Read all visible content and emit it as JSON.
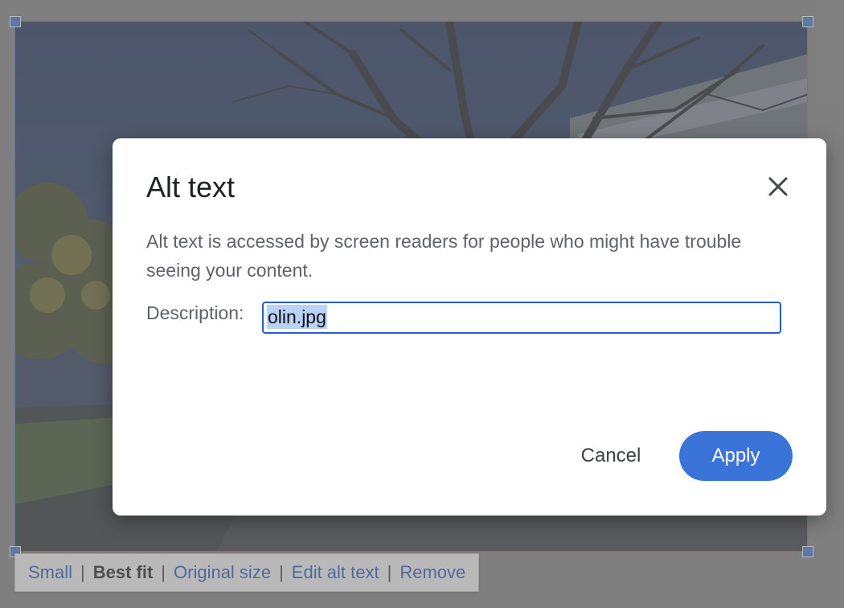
{
  "image_toolbar": {
    "small": "Small",
    "best_fit": "Best fit",
    "original_size": "Original size",
    "edit_alt_text": "Edit alt text",
    "remove": "Remove",
    "separator": "|"
  },
  "dialog": {
    "title": "Alt text",
    "close_icon": "close-icon",
    "description": "Alt text is accessed by screen readers for people who might have trouble seeing your content.",
    "field_label": "Description:",
    "field_value": "olin.jpg",
    "cancel_label": "Cancel",
    "apply_label": "Apply"
  },
  "colors": {
    "accent": "#3a74d8",
    "selection": "#b8d3f7",
    "link": "#1a4fb5"
  }
}
